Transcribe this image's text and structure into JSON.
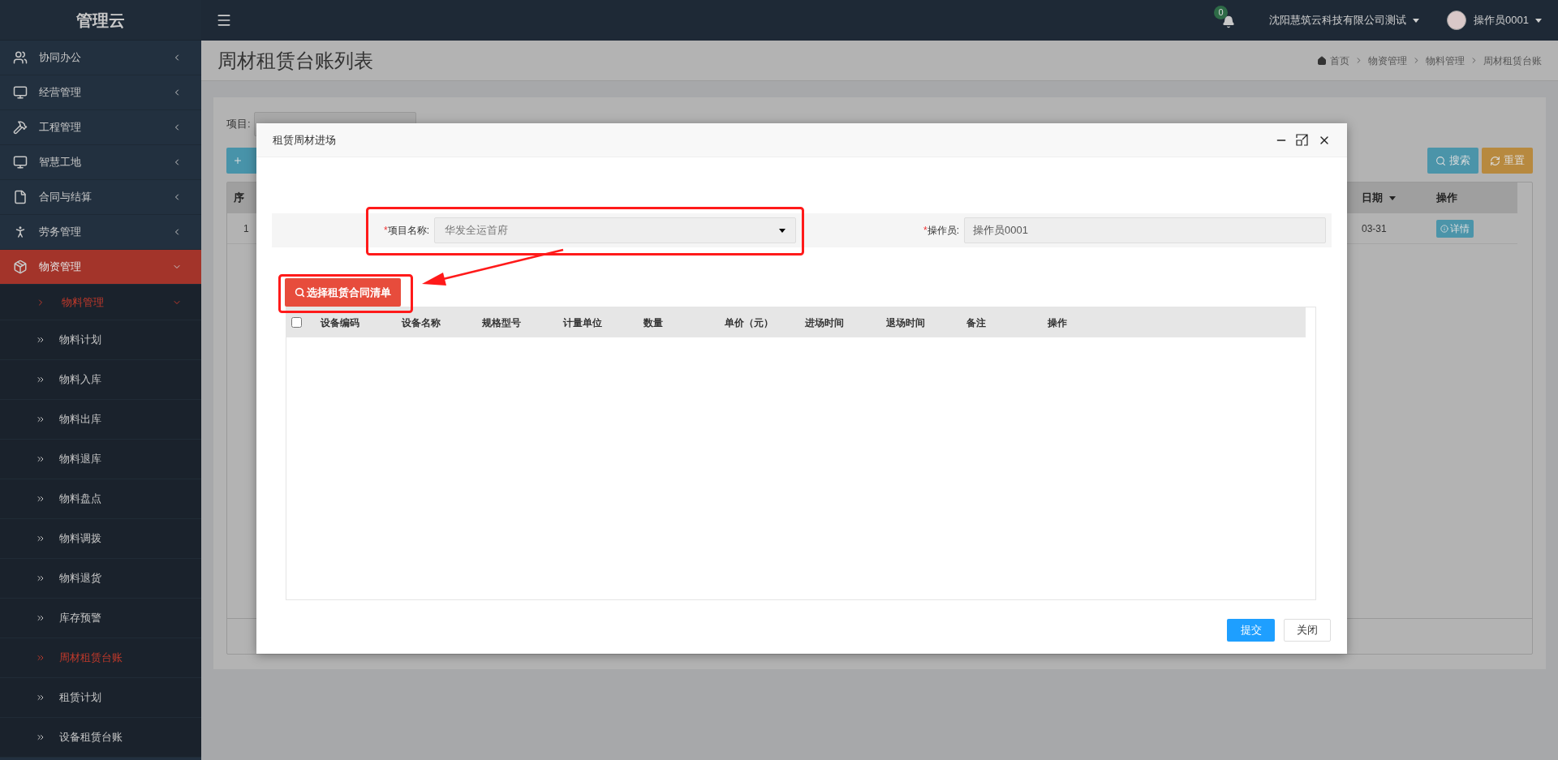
{
  "sidebar": {
    "logo": "管理云",
    "items": [
      {
        "label": "协同办公",
        "expanded": false,
        "selected": false
      },
      {
        "label": "经营管理",
        "expanded": false,
        "selected": false
      },
      {
        "label": "工程管理",
        "expanded": false,
        "selected": false
      },
      {
        "label": "智慧工地",
        "expanded": false,
        "selected": false
      },
      {
        "label": "合同与结算",
        "expanded": false,
        "selected": false
      },
      {
        "label": "劳务管理",
        "expanded": false,
        "selected": false
      },
      {
        "label": "物资管理",
        "expanded": true,
        "selected": true,
        "children": [
          {
            "label": "物料管理",
            "expanded": true,
            "selected": true,
            "children": [
              {
                "label": "物料计划",
                "selected": false
              },
              {
                "label": "物料入库",
                "selected": false
              },
              {
                "label": "物料出库",
                "selected": false
              },
              {
                "label": "物料退库",
                "selected": false
              },
              {
                "label": "物料盘点",
                "selected": false
              },
              {
                "label": "物料调拨",
                "selected": false
              },
              {
                "label": "物料退货",
                "selected": false
              },
              {
                "label": "库存预警",
                "selected": false
              },
              {
                "label": "周材租赁台账",
                "selected": true
              },
              {
                "label": "租赁计划",
                "selected": false
              },
              {
                "label": "设备租赁台账",
                "selected": false
              }
            ]
          }
        ]
      }
    ]
  },
  "header": {
    "notification_count": "0",
    "company": "沈阳慧筑云科技有限公司测试",
    "user": "操作员0001"
  },
  "page": {
    "title": "周材租赁台账列表",
    "breadcrumb": [
      "首页",
      "物资管理",
      "物料管理",
      "周材租赁台账"
    ],
    "filter_label": "项目:",
    "buttons": [
      "搜索",
      "重置"
    ],
    "table": {
      "columns": [
        "序",
        "日期",
        "操作"
      ],
      "rows": [
        {
          "cells": [
            "1",
            "03-31"
          ],
          "action": "详情"
        }
      ]
    }
  },
  "dialog": {
    "title": "租赁周材进场",
    "fields": [
      {
        "kind": "select",
        "mark": "*",
        "label": "项目名称:",
        "value": "华发全运首府"
      },
      {
        "kind": "text",
        "mark": "*",
        "label": "操作员:",
        "value": "操作员0001",
        "disabled": true
      }
    ],
    "pick_button": "选择租赁合同清单",
    "table": {
      "select_all": false,
      "columns": [
        "设备编码",
        "设备名称",
        "规格型号",
        "计量单位",
        "数量",
        "单价（元）",
        "进场时间",
        "退场时间",
        "备注",
        "操作"
      ]
    },
    "buttons": [
      "提交",
      "关闭"
    ]
  }
}
